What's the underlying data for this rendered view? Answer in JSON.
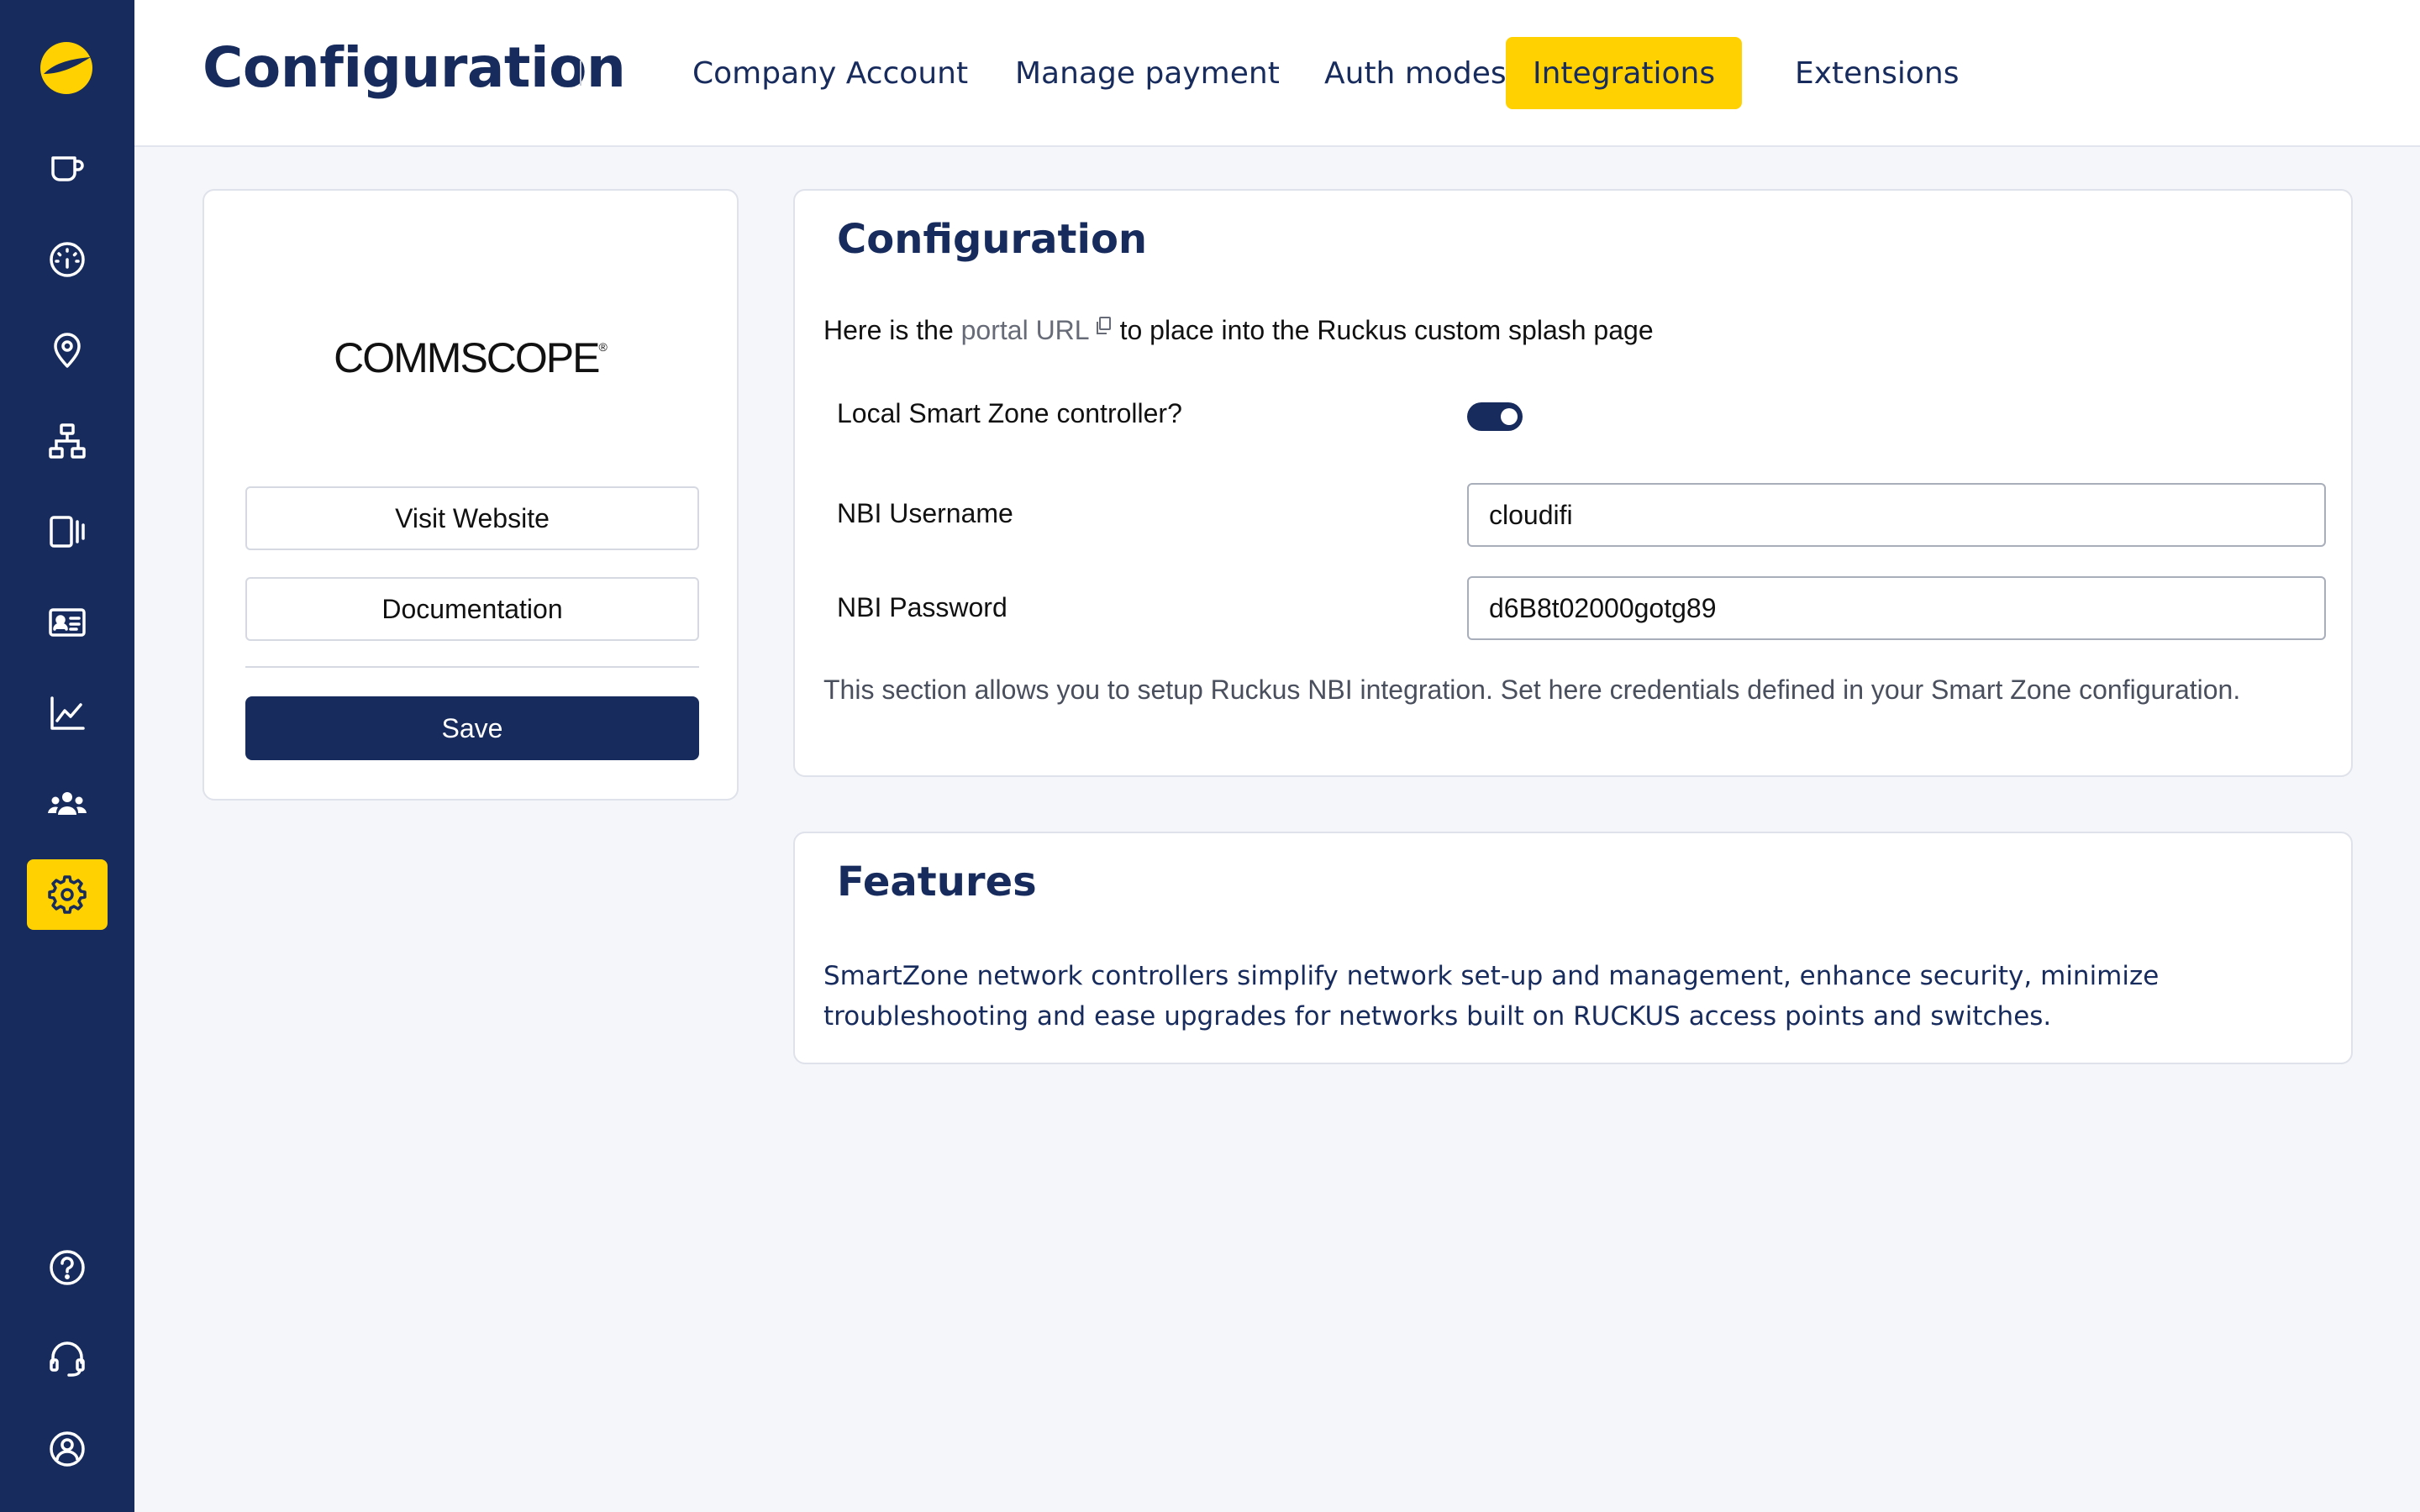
{
  "header": {
    "title": "Configuration",
    "tabs": [
      {
        "label": "Company Account"
      },
      {
        "label": "Manage payment"
      },
      {
        "label": "Auth modes"
      },
      {
        "label": "Integrations",
        "active": true
      },
      {
        "label": "Extensions"
      }
    ]
  },
  "sidebar": {
    "items": [
      {
        "icon": "cup-icon"
      },
      {
        "icon": "dashboard-icon"
      },
      {
        "icon": "location-icon"
      },
      {
        "icon": "network-icon"
      },
      {
        "icon": "devices-icon"
      },
      {
        "icon": "id-card-icon"
      },
      {
        "icon": "chart-icon"
      },
      {
        "icon": "users-icon"
      },
      {
        "icon": "gear-icon",
        "active": true
      }
    ],
    "bottom_items": [
      {
        "icon": "help-icon"
      },
      {
        "icon": "headset-icon"
      },
      {
        "icon": "user-icon"
      }
    ]
  },
  "integration": {
    "logo_text": "COMMSCOPE",
    "logo_mark": "®",
    "visit_website_label": "Visit Website",
    "documentation_label": "Documentation",
    "save_label": "Save"
  },
  "configuration": {
    "title": "Configuration",
    "portal_prefix": "Here is the ",
    "portal_link": "portal URL",
    "portal_suffix": "to place into the Ruckus custom splash page",
    "local_controller_label": "Local Smart Zone controller?",
    "local_controller_enabled": true,
    "nbi_username_label": "NBI Username",
    "nbi_username_value": "cloudifi",
    "nbi_password_label": "NBI Password",
    "nbi_password_value": "d6B8t02000gotg89",
    "help_text": "This section allows you to setup Ruckus NBI integration. Set here credentials defined in your Smart Zone configuration."
  },
  "features": {
    "title": "Features",
    "text": "SmartZone network controllers simplify network set-up and management, enhance security, minimize troubleshooting and ease upgrades for networks built on RUCKUS access points and switches."
  },
  "colors": {
    "sidebar_bg": "#172b5c",
    "accent": "#ffd100",
    "primary": "#172b5c"
  }
}
